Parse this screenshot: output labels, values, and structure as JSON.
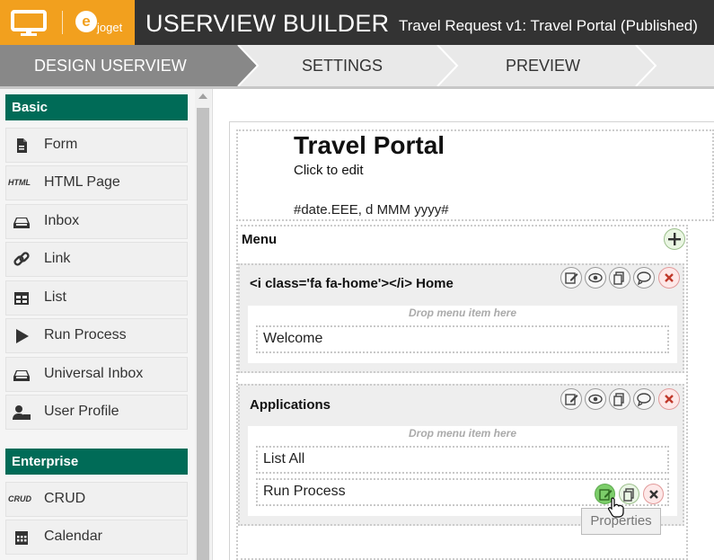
{
  "header": {
    "logo_text": "joget",
    "logo_letter": "e",
    "app_title": "USERVIEW BUILDER",
    "app_subtitle": "Travel Request v1: Travel Portal (Published)",
    "brand_color": "#f2a01e",
    "bar_color": "#333333"
  },
  "steps": [
    {
      "label": "DESIGN USERVIEW",
      "active": true
    },
    {
      "label": "SETTINGS",
      "active": false
    },
    {
      "label": "PREVIEW",
      "active": false
    }
  ],
  "sidebar": {
    "sections": [
      {
        "title": "Basic",
        "items": [
          {
            "label": "Form",
            "icon": "form-icon"
          },
          {
            "label": "HTML Page",
            "icon": "html-icon",
            "icon_text": "HTML"
          },
          {
            "label": "Inbox",
            "icon": "inbox-icon"
          },
          {
            "label": "Link",
            "icon": "link-icon"
          },
          {
            "label": "List",
            "icon": "list-icon"
          },
          {
            "label": "Run Process",
            "icon": "play-icon"
          },
          {
            "label": "Universal Inbox",
            "icon": "inbox-icon"
          },
          {
            "label": "User Profile",
            "icon": "user-profile-icon"
          }
        ]
      },
      {
        "title": "Enterprise",
        "items": [
          {
            "label": "CRUD",
            "icon": "crud-icon",
            "icon_text": "CRUD"
          },
          {
            "label": "Calendar",
            "icon": "calendar-icon"
          }
        ]
      }
    ],
    "accent_color": "#006b57"
  },
  "canvas": {
    "portal_title": "Travel Portal",
    "portal_subtitle": "Click to edit",
    "date_format": "#date.EEE, d MMM yyyy#",
    "menu_label": "Menu",
    "categories": [
      {
        "title": "<i class='fa fa-home'></i> Home",
        "drop_hint": "Drop menu item here",
        "items": [
          "Welcome"
        ]
      },
      {
        "title": "Applications",
        "drop_hint": "Drop menu item here",
        "items": [
          "List All",
          "Run Process"
        ]
      }
    ],
    "tooltip": "Properties"
  }
}
